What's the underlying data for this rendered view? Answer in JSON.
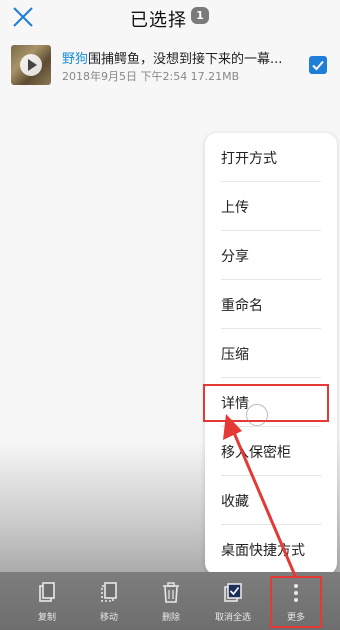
{
  "header": {
    "title": "已选择",
    "count": "1"
  },
  "file": {
    "name_highlight": "野狗",
    "name_rest": "围捕鳄鱼，没想到接下来的一幕...",
    "meta": "2018年9月5日 下午2:54 17.21MB",
    "selected": true
  },
  "menu": {
    "items": [
      {
        "label": "打开方式"
      },
      {
        "label": "上传"
      },
      {
        "label": "分享"
      },
      {
        "label": "重命名"
      },
      {
        "label": "压缩"
      },
      {
        "label": "详情"
      },
      {
        "label": "移入保密柜"
      },
      {
        "label": "收藏"
      },
      {
        "label": "桌面快捷方式"
      }
    ]
  },
  "toolbar": {
    "items": [
      {
        "label": "复制",
        "icon": "copy-icon"
      },
      {
        "label": "移动",
        "icon": "move-icon"
      },
      {
        "label": "删除",
        "icon": "trash-icon"
      },
      {
        "label": "取消全选",
        "icon": "deselect-all-icon"
      },
      {
        "label": "更多",
        "icon": "more-icon"
      }
    ]
  },
  "colors": {
    "accent": "#1e7ed8",
    "highlight_text": "#1b8fd8",
    "annotation": "#e53935"
  }
}
